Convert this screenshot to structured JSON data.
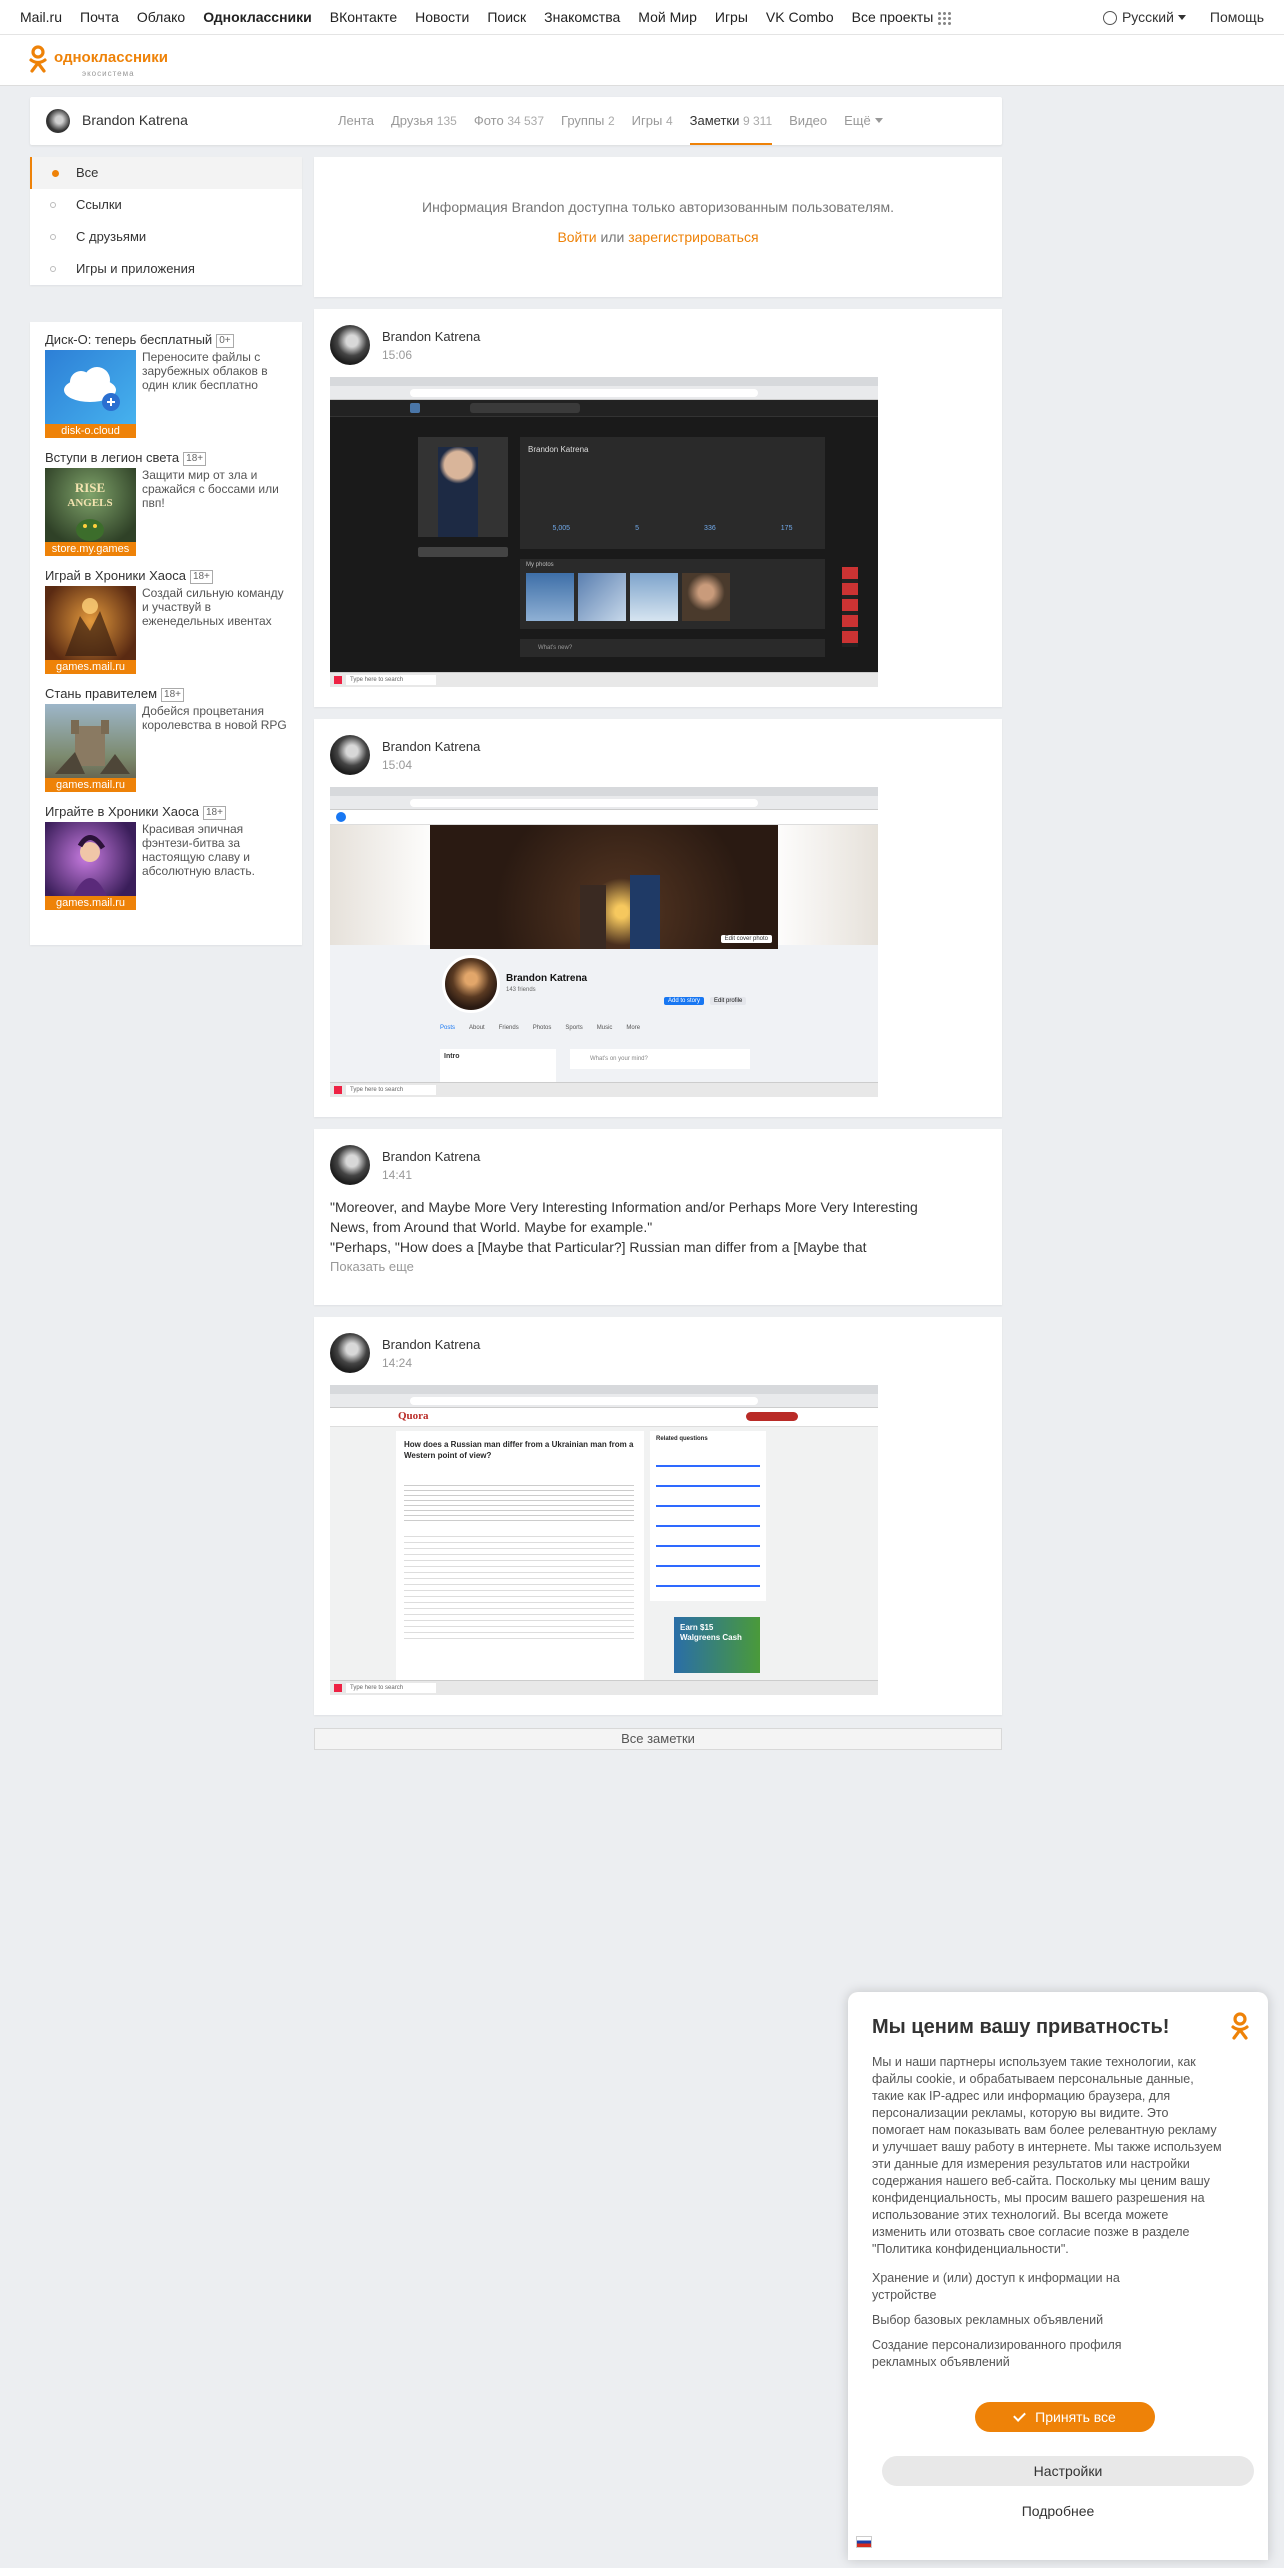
{
  "topbar": {
    "links": [
      "Mail.ru",
      "Почта",
      "Облако",
      "Одноклассники",
      "ВКонтакте",
      "Новости",
      "Поиск",
      "Знакомства",
      "Мой Мир",
      "Игры",
      "VK Combo",
      "Все проекты"
    ],
    "active_link": "Одноклассники",
    "language": "Русский",
    "help": "Помощь"
  },
  "logo": {
    "text": "одноклассники",
    "subtitle": "экосистема",
    "color": "#ee8208"
  },
  "profile": {
    "name": "Brandon Katrena",
    "tabs": [
      {
        "label": "Лента",
        "count": ""
      },
      {
        "label": "Друзья",
        "count": "135"
      },
      {
        "label": "Фото",
        "count": "34 537"
      },
      {
        "label": "Группы",
        "count": "2"
      },
      {
        "label": "Игры",
        "count": "4"
      },
      {
        "label": "Заметки",
        "count": "9 311"
      },
      {
        "label": "Видео",
        "count": ""
      },
      {
        "label": "Ещё",
        "count": ""
      }
    ],
    "active_tab": "Заметки"
  },
  "sidenav": {
    "items": [
      "Все",
      "Ссылки",
      "С друзьями",
      "Игры и приложения"
    ],
    "active": "Все"
  },
  "ads": [
    {
      "title": "Диск-О: теперь бесплатный",
      "age": "0+",
      "desc": "Переносите файлы с зарубежных облаков в один клик бесплатно",
      "source": "disk-o.cloud"
    },
    {
      "title": "Вступи в легион света",
      "age": "18+",
      "desc": "Защити мир от зла и сражайся с боссами или пвп!",
      "source": "store.my.games"
    },
    {
      "title": "Играй в Хроники Хаоса",
      "age": "18+",
      "desc": "Создай сильную команду и участвуй в еженедельных ивентах",
      "source": "games.mail.ru"
    },
    {
      "title": "Стань правителем",
      "age": "18+",
      "desc": "Добейся процветания королевства в новой RPG",
      "source": "games.mail.ru"
    },
    {
      "title": "Играйте в Хроники Хаоса",
      "age": "18+",
      "desc": "Красивая эпичная фэнтези-битва за настоящую славу и абсолютную власть.",
      "source": "games.mail.ru"
    }
  ],
  "info": {
    "message": "Информация Brandon доступна только авторизованным пользователям.",
    "login": "Войти",
    "or": "или",
    "register": "зарегистрироваться"
  },
  "posts": [
    {
      "author": "Brandon Katrena",
      "time": "15:06"
    },
    {
      "author": "Brandon Katrena",
      "time": "15:04"
    },
    {
      "author": "Brandon Katrena",
      "time": "14:41",
      "line1": "\"Moreover, and Maybe More Very Interesting Information and/or Perhaps More Very Interesting",
      "line2": "News, from Around that World. Maybe for example.\"",
      "line3": "\"Perhaps, \"How does a [Maybe that Particular?] Russian man differ from a [Maybe that",
      "more": "Показать еще"
    },
    {
      "author": "Brandon Katrena",
      "time": "14:24"
    }
  ],
  "screens": {
    "vk": {
      "name": "Brandon Katrena",
      "counts": [
        "5,005",
        "5",
        "336",
        "175"
      ],
      "section": "My photos",
      "post": "What's new?",
      "taskbar_search": "Type here to search"
    },
    "fb": {
      "name": "Brandon Katrena",
      "friends": "143 friends",
      "add_story": "Add to story",
      "edit_profile": "Edit profile",
      "edit_cover": "Edit cover photo",
      "nav": [
        "Posts",
        "About",
        "Friends",
        "Photos",
        "Sports",
        "Music",
        "More"
      ],
      "intro": "Intro",
      "prompt": "What's on your mind?",
      "taskbar_search": "Type here to search"
    },
    "quora": {
      "brand": "Quora",
      "question": "How does a Russian man differ from a Ukrainian man from a Western point of view?",
      "related": "Related questions",
      "ad": "Earn $15 Walgreens Cash",
      "taskbar_search": "Type here to search"
    }
  },
  "all_notes": "Все заметки",
  "cookie": {
    "title": "Мы ценим вашу приватность!",
    "body": "Мы и наши партнеры используем такие технологии, как файлы cookie, и обрабатываем персональные данные, такие как IP-адрес или информацию браузера, для персонализации рекламы, которую вы видите. Это помогает нам показывать вам более релевантную рекламу и улучшает вашу работу в интернете. Мы также используем эти данные для измерения результатов или настройки содержания нашего веб-сайта. Поскольку мы ценим вашу конфиденциальность, мы просим вашего разрешения на использование этих технологий. Вы всегда можете изменить или отозвать свое согласие позже в разделе \"Политика конфиденциальности\".",
    "purposes": [
      "Хранение и (или) доступ к информации на устройстве",
      "Выбор базовых рекламных объявлений",
      "Создание персонализированного профиля рекламных объявлений"
    ],
    "accept": "Принять все",
    "settings": "Настройки",
    "more": "Подробнее"
  },
  "colors": {
    "accent": "#ee8208",
    "page_bg": "#eceef1"
  }
}
